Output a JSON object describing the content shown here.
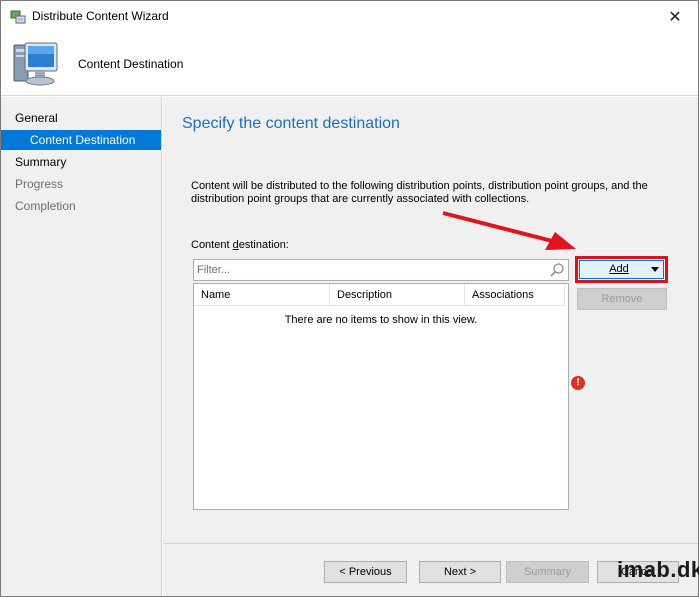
{
  "window": {
    "title": "Distribute Content Wizard",
    "close_glyph": "✕"
  },
  "header": {
    "title": "Content Destination",
    "icon": "computer-monitor-icon"
  },
  "nav": {
    "items": [
      {
        "label": "General",
        "state": "normal"
      },
      {
        "label": "Content Destination",
        "state": "selected"
      },
      {
        "label": "Summary",
        "state": "normal"
      },
      {
        "label": "Progress",
        "state": "disabled"
      },
      {
        "label": "Completion",
        "state": "disabled"
      }
    ]
  },
  "main": {
    "title": "Specify the content destination",
    "description": "Content will be distributed to the following distribution points, distribution point groups, and the distribution point groups that are currently associated with collections.",
    "destination_label": "Content destination:",
    "filter_placeholder": "Filter...",
    "columns": [
      "Name",
      "Description",
      "Associations"
    ],
    "empty_message": "There are no items to show in this view.",
    "add_button": "Add",
    "remove_button": "Remove",
    "error_glyph": "!"
  },
  "footer": {
    "previous": "< Previous",
    "next": "Next >",
    "summary": "Summary",
    "cancel": "Cancel"
  },
  "watermark": "imab.dk",
  "colors": {
    "accent": "#0078d7",
    "title_blue": "#1e6ebe",
    "highlight_red": "#d6141d",
    "error_red": "#e0302a"
  }
}
